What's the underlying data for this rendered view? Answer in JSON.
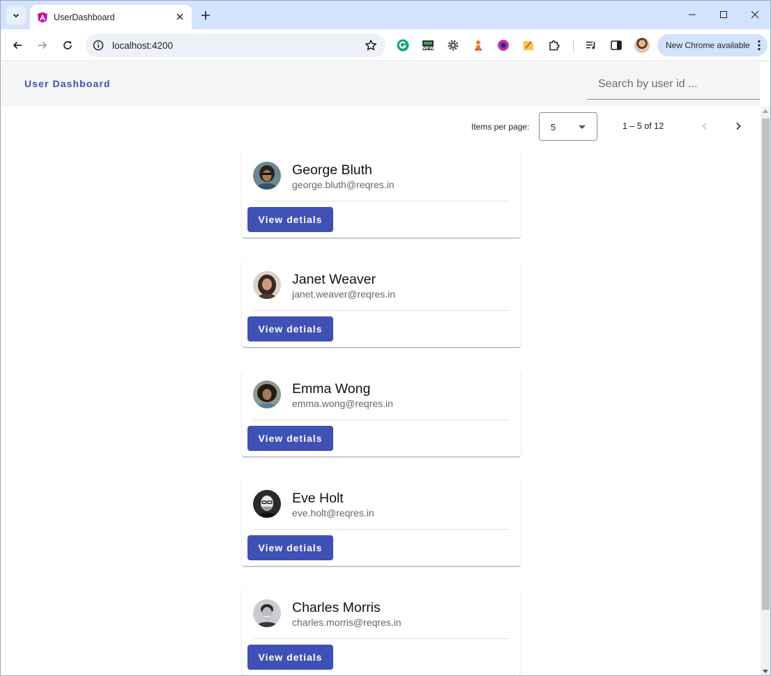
{
  "browser": {
    "tab_title": "UserDashboard",
    "url": "localhost:4200",
    "update_label": "New Chrome available"
  },
  "app": {
    "brand": "User Dashboard",
    "search_placeholder": "Search by user id ..."
  },
  "paginator": {
    "items_per_page_label": "Items per page:",
    "page_size": "5",
    "range_label": "1 – 5 of 12"
  },
  "users": [
    {
      "name": "George Bluth",
      "email": "george.bluth@reqres.in",
      "button": "View detials"
    },
    {
      "name": "Janet Weaver",
      "email": "janet.weaver@reqres.in",
      "button": "View detials"
    },
    {
      "name": "Emma Wong",
      "email": "emma.wong@reqres.in",
      "button": "View detials"
    },
    {
      "name": "Eve Holt",
      "email": "eve.holt@reqres.in",
      "button": "View detials"
    },
    {
      "name": "Charles Morris",
      "email": "charles.morris@reqres.in",
      "button": "View detials"
    }
  ],
  "colors": {
    "primary": "#3f51b5",
    "tab_strip": "#d3e3fd",
    "header_bg": "#f5f5f5"
  }
}
